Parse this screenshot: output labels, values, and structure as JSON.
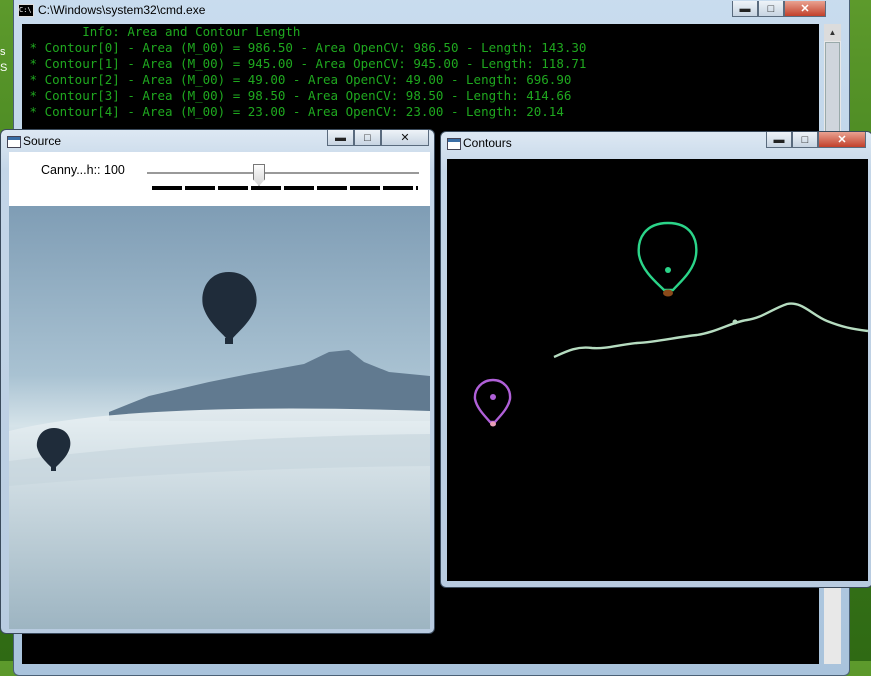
{
  "desktop": {
    "fragments": [
      "s",
      "S"
    ]
  },
  "cmd_window": {
    "title": "C:\\Windows\\system32\\cmd.exe",
    "icon": "C:\\",
    "buttons": {
      "minimize": "minimize-icon",
      "maximize": "maximize-icon",
      "close": "close-icon"
    },
    "lines": [
      "        Info: Area and Contour Length",
      " * Contour[0] - Area (M_00) = 986.50 - Area OpenCV: 986.50 - Length: 143.30",
      " * Contour[1] - Area (M_00) = 945.00 - Area OpenCV: 945.00 - Length: 118.71",
      " * Contour[2] - Area (M_00) = 49.00 - Area OpenCV: 49.00 - Length: 696.90",
      " * Contour[3] - Area (M_00) = 98.50 - Area OpenCV: 98.50 - Length: 414.66",
      " * Contour[4] - Area (M_00) = 23.00 - Area OpenCV: 23.00 - Length: 20.14"
    ]
  },
  "source_window": {
    "title": "Source",
    "trackbar": {
      "label": "Canny...h:: 100",
      "value": 100
    }
  },
  "contours_window": {
    "title": "Contours"
  },
  "colors": {
    "console_text": "#1fa81f",
    "contour_large_balloon": "#2bd489",
    "contour_small_balloon": "#b060d8",
    "contour_mountain": "#b6dcc0",
    "balloon_silhouette": "#1f2c3a"
  }
}
